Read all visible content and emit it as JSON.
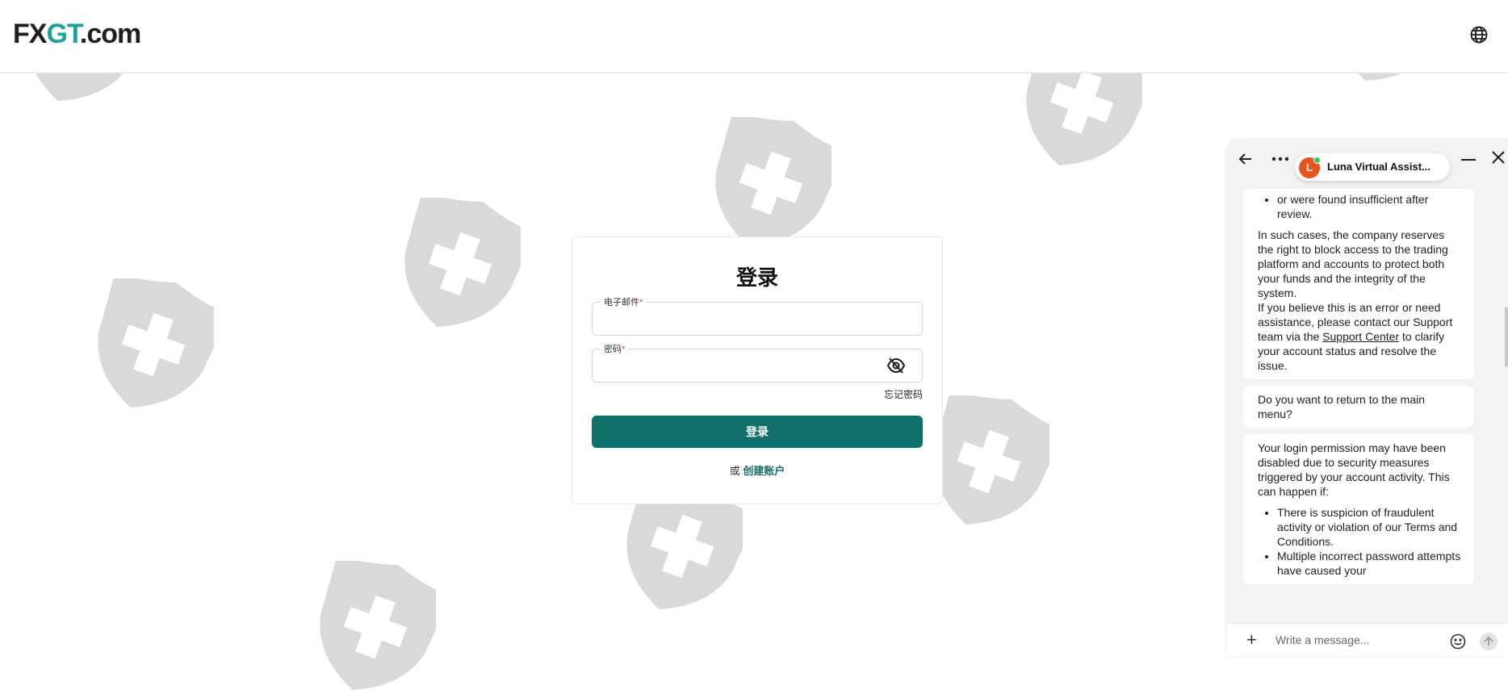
{
  "header": {
    "logo_fx": "FX",
    "logo_gt": "GT",
    "logo_domain": ".com",
    "language_icon": "globe-icon"
  },
  "login": {
    "title": "登录",
    "email_label": "电子邮件",
    "email_required": "*",
    "email_value": "",
    "password_label": "密码",
    "password_required": "*",
    "password_value": "",
    "toggle_visibility_icon": "eye-off-icon",
    "forgot_password": "忘记密码",
    "submit_label": "登录",
    "create_prefix": "或",
    "create_link": "创建账户"
  },
  "chat": {
    "agent_initial": "L",
    "agent_name": "Luna Virtual Assist...",
    "back_icon": "arrow-left-icon",
    "more_icon": "more-dots-icon",
    "minimize_icon": "minimize-icon",
    "close_icon": "close-icon",
    "msg1_bullet": "or were found insufficient after review.",
    "msg1_p1": "In such cases, the company reserves the right to block access to the trading platform and accounts to protect both your funds and the integrity of the system.",
    "msg1_p2_pre": "If you believe this is an error or need assistance, please contact our Support team via the ",
    "msg1_p2_link": "Support Center",
    "msg1_p2_post": " to clarify your account status and resolve the issue.",
    "msg2": "Do you want to return to the main menu?",
    "msg3_intro": "Your login permission may have been disabled due to security measures triggered by your account activity. This can happen if:",
    "msg3_bullets": [
      "There is suspicion of fraudulent activity or violation of our Terms and Conditions.",
      "Multiple incorrect password attempts have caused your"
    ],
    "composer_placeholder": "Write a message...",
    "emoji_icon": "emoji-icon",
    "send_icon": "send-icon",
    "attach_icon": "plus-icon"
  },
  "colors": {
    "brand": "#10706b",
    "logo_accent": "#1aa39a",
    "avatar": "#e8541a"
  }
}
